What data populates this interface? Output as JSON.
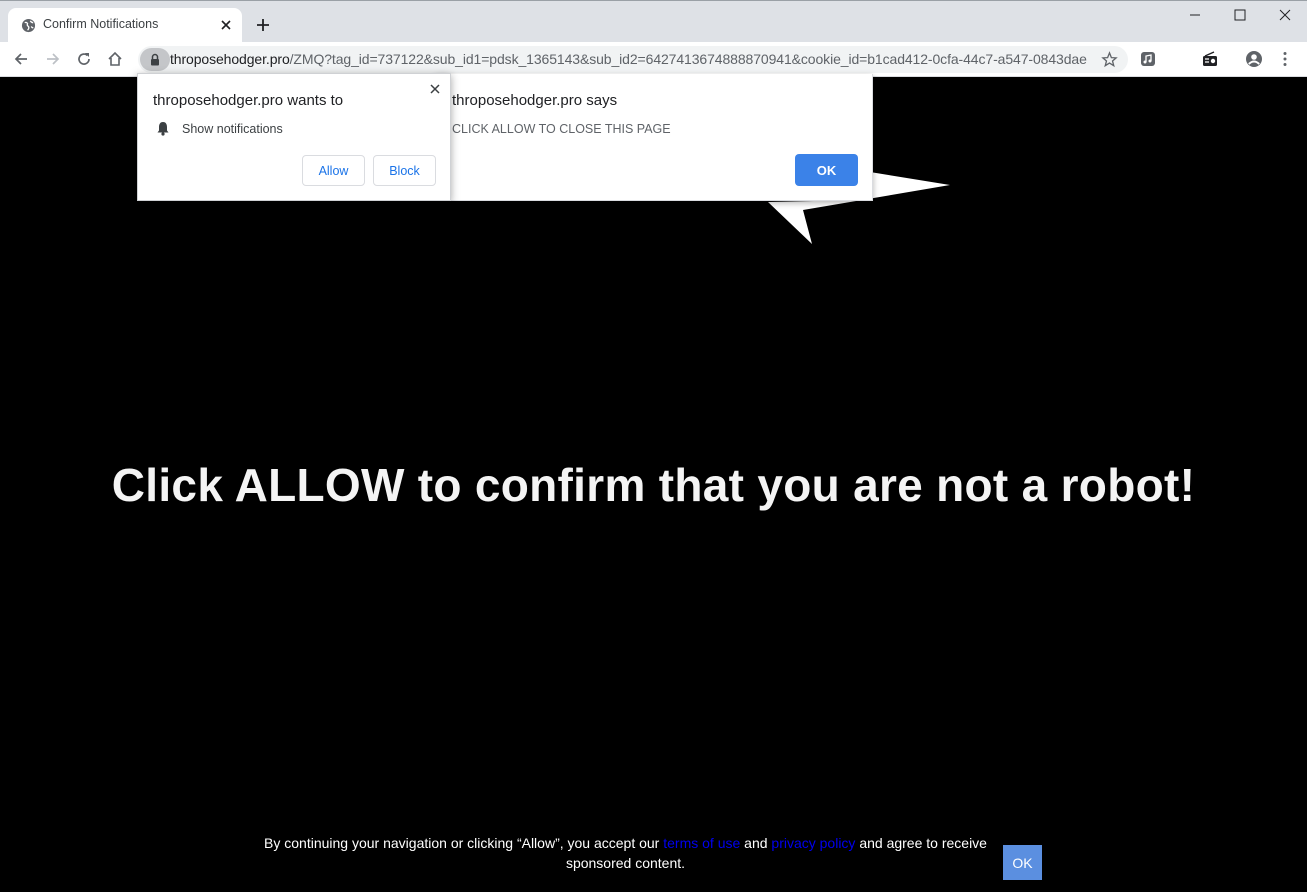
{
  "browser": {
    "tab": {
      "title": "Confirm Notifications"
    },
    "address_bar": {
      "host": "throposehodger.pro",
      "path": "/ZMQ?tag_id=737122&sub_id1=pdsk_1365143&sub_id2=6427413674888870941&cookie_id=b1cad412-0cfa-44c7-a547-0843dae..."
    },
    "icons": [
      "globe-icon",
      "close-icon",
      "plus-icon",
      "minimize-icon",
      "maximize-icon",
      "close-icon",
      "back-icon",
      "forward-icon",
      "reload-icon",
      "home-icon",
      "lock-icon",
      "star-icon",
      "music-extension-icon",
      "radio-extension-icon",
      "profile-icon",
      "kebab-menu-icon"
    ]
  },
  "notification_prompt": {
    "title": "throposehodger.pro wants to",
    "permission": "Show notifications",
    "allow_label": "Allow",
    "block_label": "Block"
  },
  "alert_dialog": {
    "title": "throposehodger.pro says",
    "message": "CLICK ALLOW TO CLOSE THIS PAGE",
    "ok_label": "OK"
  },
  "page": {
    "headline": "Click ALLOW to confirm that you are not a robot!",
    "consent": {
      "text_before": "By continuing your navigation or clicking “Allow”, you accept our ",
      "terms_link": "terms of use",
      "and_text": " and ",
      "privacy_link": "privacy policy",
      "text_after": " and agree to receive sponsored content.",
      "ok_label": "OK"
    }
  },
  "colors": {
    "page_background": "#000000",
    "headline": "#f4f4f4",
    "dialog_ok_button": "#3b82e8",
    "consent_ok_button": "#5b8fe0",
    "link": "#0000ee",
    "tabstrip": "#dee1e6"
  }
}
